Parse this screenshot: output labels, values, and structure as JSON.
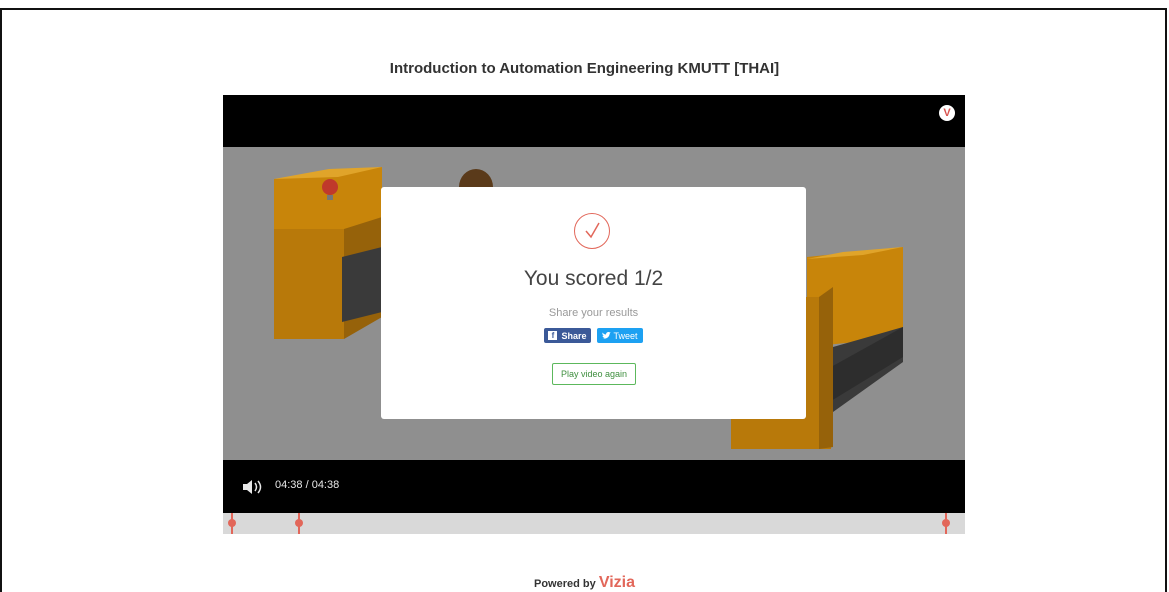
{
  "page": {
    "title": "Introduction to Automation Engineering KMUTT [THAI]"
  },
  "player": {
    "logo_letter": "V",
    "time_display": "04:38 / 04:38",
    "timeline_markers": [
      0.012,
      0.102,
      0.975
    ]
  },
  "modal": {
    "score_text": "You scored 1/2",
    "share_label": "Share your results",
    "facebook_label": "Share",
    "facebook_icon_letter": "f",
    "twitter_label": "Tweet",
    "replay_label": "Play video again"
  },
  "footer": {
    "powered_prefix": "Powered by",
    "brand": "Vizia"
  },
  "colors": {
    "accent": "#e2675a",
    "facebook": "#3b5998",
    "twitter": "#1da1f2",
    "replay_border": "#5cb85c"
  }
}
